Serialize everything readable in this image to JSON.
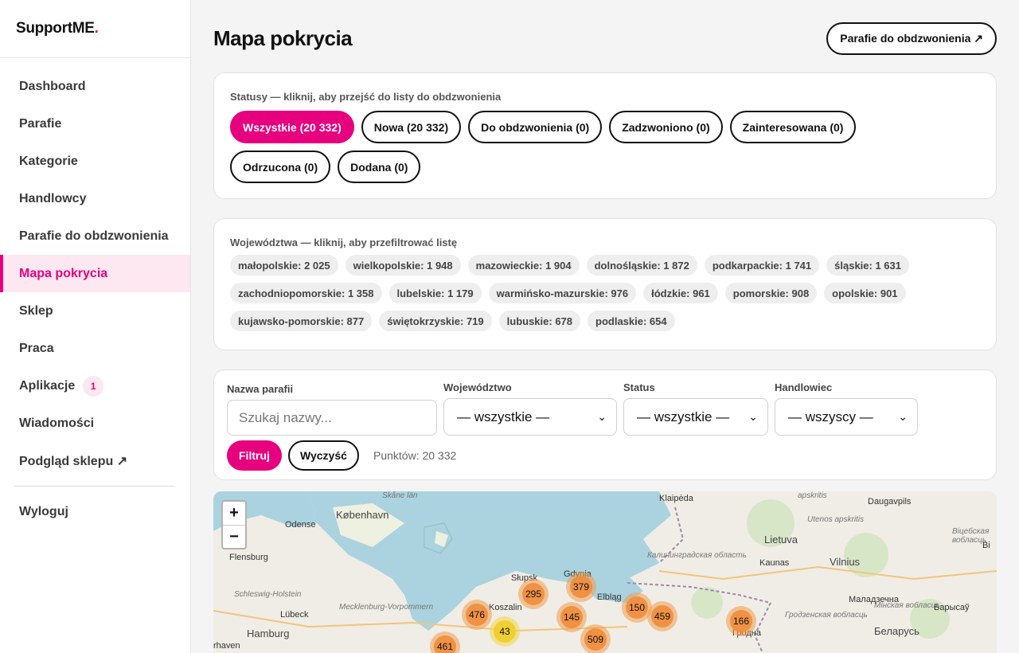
{
  "brand": {
    "name": "SupportME",
    "dot": "."
  },
  "nav": {
    "items": [
      {
        "label": "Dashboard"
      },
      {
        "label": "Parafie"
      },
      {
        "label": "Kategorie"
      },
      {
        "label": "Handlowcy"
      },
      {
        "label": "Parafie do obdzwonienia"
      },
      {
        "label": "Mapa pokrycia"
      },
      {
        "label": "Sklep"
      },
      {
        "label": "Praca"
      },
      {
        "label": "Aplikacje",
        "badge": "1"
      },
      {
        "label": "Wiadomości"
      },
      {
        "label": "Podgląd sklepu ↗"
      }
    ],
    "logout": "Wyloguj"
  },
  "page": {
    "title": "Mapa pokrycia",
    "top_button": "Parafie do obdzwonienia ↗"
  },
  "statuses": {
    "label": "Statusy — kliknij, aby przejść do listy do obdzwonienia",
    "items": [
      {
        "label": "Wszystkie (20 332)",
        "active": true
      },
      {
        "label": "Nowa (20 332)"
      },
      {
        "label": "Do obdzwonienia (0)"
      },
      {
        "label": "Zadzwoniono (0)"
      },
      {
        "label": "Zainteresowana (0)"
      },
      {
        "label": "Odrzucona (0)"
      },
      {
        "label": "Dodana (0)"
      }
    ]
  },
  "regions": {
    "label": "Województwa — kliknij, aby przefiltrować listę",
    "items": [
      "małopolskie: 2 025",
      "wielkopolskie: 1 948",
      "mazowieckie: 1 904",
      "dolnośląskie: 1 872",
      "podkarpackie: 1 741",
      "śląskie: 1 631",
      "zachodniopomorskie: 1 358",
      "lubelskie: 1 179",
      "warmińsko-mazurskie: 976",
      "łódzkie: 961",
      "pomorskie: 908",
      "opolskie: 901",
      "kujawsko-pomorskie: 877",
      "świętokrzyskie: 719",
      "lubuskie: 678",
      "podlaskie: 654"
    ]
  },
  "filters": {
    "name_label": "Nazwa parafii",
    "name_placeholder": "Szukaj nazwy...",
    "region_label": "Województwo",
    "region_value": "— wszystkie —",
    "status_label": "Status",
    "status_value": "— wszystkie —",
    "rep_label": "Handlowiec",
    "rep_value": "— wszyscy —",
    "filter_button": "Filtruj",
    "clear_button": "Wyczyść",
    "points_text": "Punktów: 20 332"
  },
  "map": {
    "zoom_in": "+",
    "zoom_out": "−",
    "clusters": [
      "295",
      "379",
      "476",
      "145",
      "43",
      "509",
      "150",
      "459",
      "166",
      "461"
    ],
    "labels": {
      "kobenhavn": "København",
      "odense": "Odense",
      "skane": "Skåne län",
      "flensburg": "Flensburg",
      "schleswig": "Schleswig-Holstein",
      "lubeck": "Lübeck",
      "mecklenburg": "Mecklenburg-Vorpommern",
      "hamburg": "Hamburg",
      "haven": "rhaven",
      "slupsk": "Słupsk",
      "gdynia": "Gdynia",
      "elblag": "Elbląg",
      "koszalin": "Koszalin",
      "klaipeda": "Klaipėda",
      "kaliningrad": "Калининградская область",
      "lietuva": "Lietuva",
      "kaunas": "Kaunas",
      "vilnius": "Vilnius",
      "daugavpils": "Daugavpils",
      "utenos": "Utenos apskritis",
      "apskritis": "apskritis",
      "vitebsk": "Віцебская вобласць",
      "minsk_obl": "Мінская вобласць",
      "grodno_obl": "Гродзенская вобласць",
      "grodno": "Гродна",
      "belarus": "Беларусь",
      "molodechno": "Маладзечна",
      "baryshaw": "Барысаў",
      "bi": "Bi"
    }
  }
}
